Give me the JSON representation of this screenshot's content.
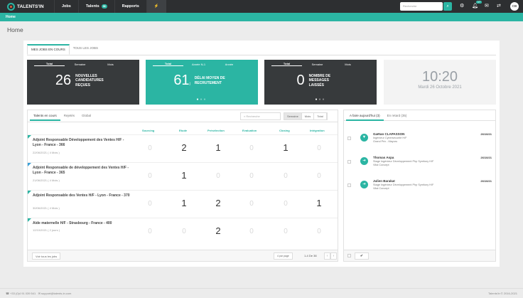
{
  "topbar": {
    "logo": "TALENTS'IN",
    "nav": [
      {
        "label": "Jobs"
      },
      {
        "label": "Talents",
        "badge": "98"
      },
      {
        "label": "Rapports"
      }
    ],
    "search_placeholder": "Recherche",
    "notif_badge": "17",
    "avatar": "CB"
  },
  "breadcrumb": "Home",
  "page_title": "Home",
  "tabs": [
    "MES JOBS EN COURS",
    "TOUS LES JOBS"
  ],
  "stats": [
    {
      "tabs": [
        "Total",
        "Semaine",
        "Mois"
      ],
      "number": "26",
      "label": "Nouvelles candidatures reçues"
    },
    {
      "tabs": [
        "Total",
        "Année N-1",
        "Année"
      ],
      "number": "61",
      "unit": "j",
      "label": "Délai moyen de recrutement"
    },
    {
      "tabs": [
        "Total",
        "Semaine",
        "Mois"
      ],
      "number": "0",
      "label": "Nombre de messages laissés"
    }
  ],
  "clock": {
    "time": "10:20",
    "date": "Mardi 26 Octobre 2021"
  },
  "left": {
    "tabs": [
      "Talents en cours",
      "Rejetés",
      "Global"
    ],
    "search_placeholder": "Recherche",
    "filters": [
      "Semaine",
      "Mois",
      "Total"
    ],
    "columns": [
      "Sourcing",
      "Etude",
      "Présélection",
      "Evaluation",
      "Closing",
      "Intégration"
    ],
    "rows": [
      {
        "title": "Adjoint Responsable Développement des Ventes H/F - Lyon - France - 366",
        "date": "22/06/2021 ( 4 Mois )",
        "values": [
          "0",
          "2",
          "1",
          "0",
          "1",
          "0"
        ]
      },
      {
        "title": "Adjoint Responsable de développement des Ventes H/F - Lyon - France - 365",
        "date": "21/06/2021 ( 4 Mois )",
        "values": [
          "0",
          "1",
          "0",
          "0",
          "0",
          "0"
        ]
      },
      {
        "title": "Adjoint Responsable des Ventes H/F - Lyon - France - 370",
        "date": "30/06/2021 ( 4 Mois )",
        "values": [
          "0",
          "1",
          "2",
          "0",
          "0",
          "1"
        ]
      },
      {
        "title": "Aide maternelle H/F - Strasbourg - France - 400",
        "date": "12/10/2021 ( 2 jours )",
        "values": [
          "0",
          "0",
          "2",
          "0",
          "0",
          "0"
        ]
      }
    ],
    "footer_button": "Voir tous les jobs",
    "per_page": "4 par page",
    "pagination": "1-4 De 38"
  },
  "right": {
    "tabs": [
      "A faire aujourd'hui (3)",
      "En retard (35)"
    ],
    "tasks": [
      {
        "name": "Gaëtan CLAPASSON",
        "lines": [
          "Ingénieur Cybersécurité H/F",
          "Grand Prix - Mayoru"
        ],
        "date": "26/10/21",
        "icon": "filter-icon"
      },
      {
        "name": "Thomas Aspa",
        "lines": [
          "Stage Ingénieur Développement Php Symfony H/F",
          "Vital Concept"
        ],
        "date": "26/10/21",
        "icon": "forward-icon"
      },
      {
        "name": "Julien Barakat",
        "lines": [
          "Stage Ingénieur Développement Php Symfony H/F",
          "Vital Concept"
        ],
        "date": "26/10/21",
        "icon": "forward-icon"
      }
    ],
    "ok": "✔"
  },
  "footer": {
    "phone": "+33 (0)4 91 039 541",
    "email": "support@talents-in.com",
    "copyright": "Talents'in © 2016-2021"
  },
  "colors": {
    "accent": "#2bb5a3",
    "dark": "#373a3c"
  }
}
